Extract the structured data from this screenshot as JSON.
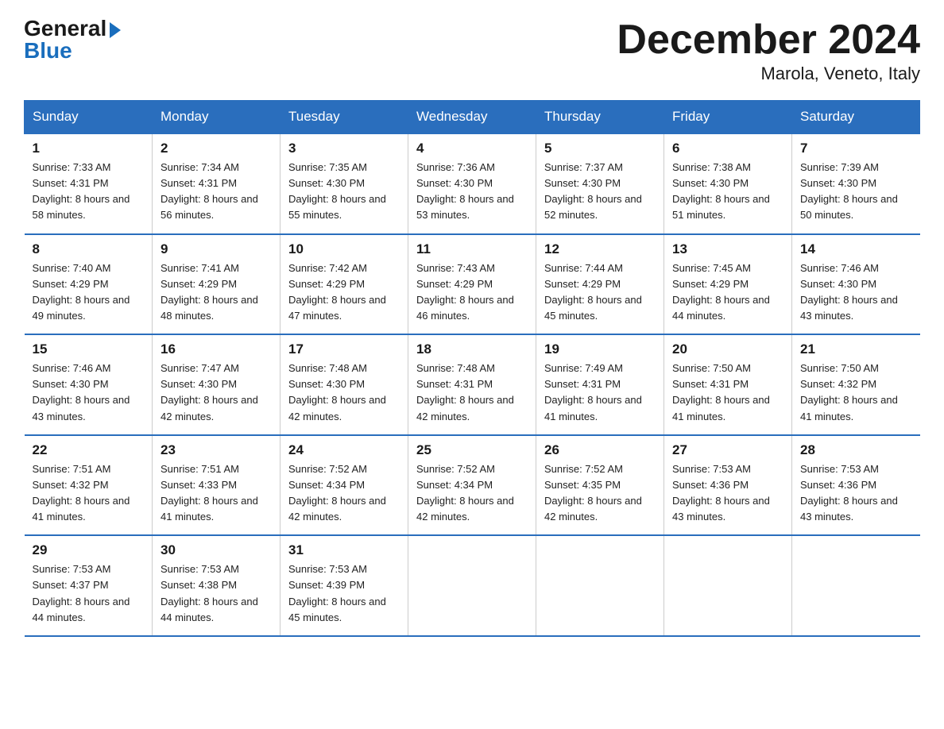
{
  "header": {
    "logo_general": "General",
    "logo_blue": "Blue",
    "month_title": "December 2024",
    "subtitle": "Marola, Veneto, Italy"
  },
  "days_of_week": [
    "Sunday",
    "Monday",
    "Tuesday",
    "Wednesday",
    "Thursday",
    "Friday",
    "Saturday"
  ],
  "weeks": [
    [
      {
        "num": "1",
        "sunrise": "7:33 AM",
        "sunset": "4:31 PM",
        "daylight": "8 hours and 58 minutes."
      },
      {
        "num": "2",
        "sunrise": "7:34 AM",
        "sunset": "4:31 PM",
        "daylight": "8 hours and 56 minutes."
      },
      {
        "num": "3",
        "sunrise": "7:35 AM",
        "sunset": "4:30 PM",
        "daylight": "8 hours and 55 minutes."
      },
      {
        "num": "4",
        "sunrise": "7:36 AM",
        "sunset": "4:30 PM",
        "daylight": "8 hours and 53 minutes."
      },
      {
        "num": "5",
        "sunrise": "7:37 AM",
        "sunset": "4:30 PM",
        "daylight": "8 hours and 52 minutes."
      },
      {
        "num": "6",
        "sunrise": "7:38 AM",
        "sunset": "4:30 PM",
        "daylight": "8 hours and 51 minutes."
      },
      {
        "num": "7",
        "sunrise": "7:39 AM",
        "sunset": "4:30 PM",
        "daylight": "8 hours and 50 minutes."
      }
    ],
    [
      {
        "num": "8",
        "sunrise": "7:40 AM",
        "sunset": "4:29 PM",
        "daylight": "8 hours and 49 minutes."
      },
      {
        "num": "9",
        "sunrise": "7:41 AM",
        "sunset": "4:29 PM",
        "daylight": "8 hours and 48 minutes."
      },
      {
        "num": "10",
        "sunrise": "7:42 AM",
        "sunset": "4:29 PM",
        "daylight": "8 hours and 47 minutes."
      },
      {
        "num": "11",
        "sunrise": "7:43 AM",
        "sunset": "4:29 PM",
        "daylight": "8 hours and 46 minutes."
      },
      {
        "num": "12",
        "sunrise": "7:44 AM",
        "sunset": "4:29 PM",
        "daylight": "8 hours and 45 minutes."
      },
      {
        "num": "13",
        "sunrise": "7:45 AM",
        "sunset": "4:29 PM",
        "daylight": "8 hours and 44 minutes."
      },
      {
        "num": "14",
        "sunrise": "7:46 AM",
        "sunset": "4:30 PM",
        "daylight": "8 hours and 43 minutes."
      }
    ],
    [
      {
        "num": "15",
        "sunrise": "7:46 AM",
        "sunset": "4:30 PM",
        "daylight": "8 hours and 43 minutes."
      },
      {
        "num": "16",
        "sunrise": "7:47 AM",
        "sunset": "4:30 PM",
        "daylight": "8 hours and 42 minutes."
      },
      {
        "num": "17",
        "sunrise": "7:48 AM",
        "sunset": "4:30 PM",
        "daylight": "8 hours and 42 minutes."
      },
      {
        "num": "18",
        "sunrise": "7:48 AM",
        "sunset": "4:31 PM",
        "daylight": "8 hours and 42 minutes."
      },
      {
        "num": "19",
        "sunrise": "7:49 AM",
        "sunset": "4:31 PM",
        "daylight": "8 hours and 41 minutes."
      },
      {
        "num": "20",
        "sunrise": "7:50 AM",
        "sunset": "4:31 PM",
        "daylight": "8 hours and 41 minutes."
      },
      {
        "num": "21",
        "sunrise": "7:50 AM",
        "sunset": "4:32 PM",
        "daylight": "8 hours and 41 minutes."
      }
    ],
    [
      {
        "num": "22",
        "sunrise": "7:51 AM",
        "sunset": "4:32 PM",
        "daylight": "8 hours and 41 minutes."
      },
      {
        "num": "23",
        "sunrise": "7:51 AM",
        "sunset": "4:33 PM",
        "daylight": "8 hours and 41 minutes."
      },
      {
        "num": "24",
        "sunrise": "7:52 AM",
        "sunset": "4:34 PM",
        "daylight": "8 hours and 42 minutes."
      },
      {
        "num": "25",
        "sunrise": "7:52 AM",
        "sunset": "4:34 PM",
        "daylight": "8 hours and 42 minutes."
      },
      {
        "num": "26",
        "sunrise": "7:52 AM",
        "sunset": "4:35 PM",
        "daylight": "8 hours and 42 minutes."
      },
      {
        "num": "27",
        "sunrise": "7:53 AM",
        "sunset": "4:36 PM",
        "daylight": "8 hours and 43 minutes."
      },
      {
        "num": "28",
        "sunrise": "7:53 AM",
        "sunset": "4:36 PM",
        "daylight": "8 hours and 43 minutes."
      }
    ],
    [
      {
        "num": "29",
        "sunrise": "7:53 AM",
        "sunset": "4:37 PM",
        "daylight": "8 hours and 44 minutes."
      },
      {
        "num": "30",
        "sunrise": "7:53 AM",
        "sunset": "4:38 PM",
        "daylight": "8 hours and 44 minutes."
      },
      {
        "num": "31",
        "sunrise": "7:53 AM",
        "sunset": "4:39 PM",
        "daylight": "8 hours and 45 minutes."
      },
      {
        "num": "",
        "sunrise": "",
        "sunset": "",
        "daylight": ""
      },
      {
        "num": "",
        "sunrise": "",
        "sunset": "",
        "daylight": ""
      },
      {
        "num": "",
        "sunrise": "",
        "sunset": "",
        "daylight": ""
      },
      {
        "num": "",
        "sunrise": "",
        "sunset": "",
        "daylight": ""
      }
    ]
  ]
}
